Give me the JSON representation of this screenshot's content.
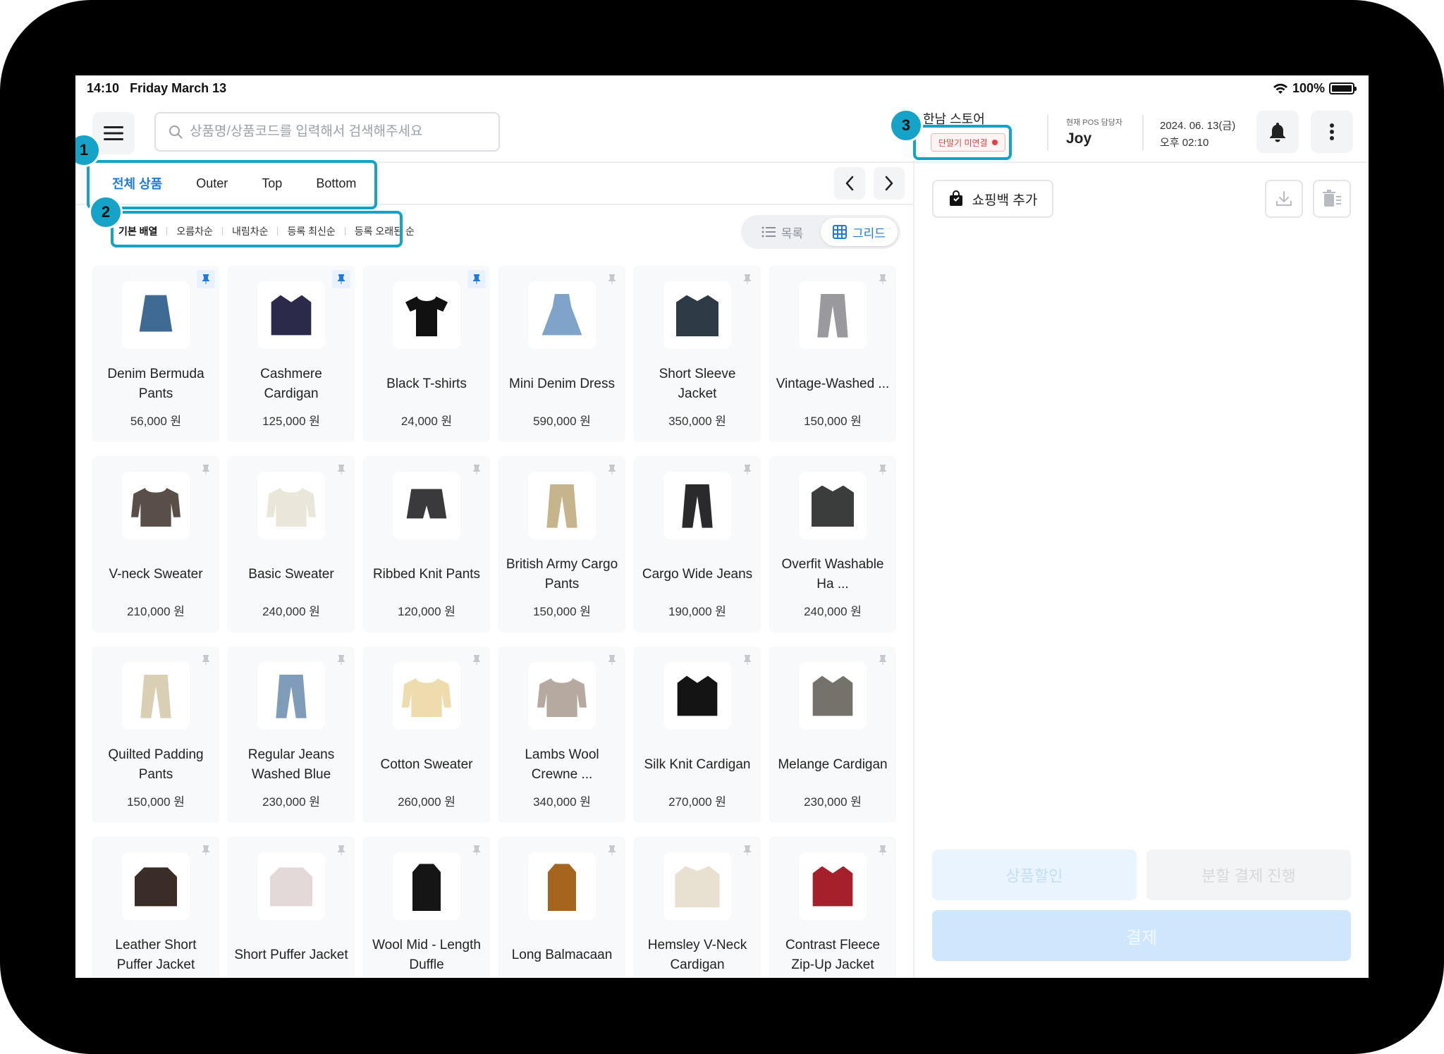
{
  "status_bar": {
    "time": "14:10",
    "date": "Friday March 13",
    "battery": "100%"
  },
  "header": {
    "search_placeholder": "상품명/상품코드를 입력해서 검색해주세요",
    "store_name": "한남 스토어",
    "terminal_status": "단말기 미연결",
    "staff_label": "현재 POS 담당자",
    "staff_name": "Joy",
    "date": "2024. 06. 13(금)",
    "time": "오후 02:10"
  },
  "tabs": [
    {
      "label": "전체 상품",
      "active": true
    },
    {
      "label": "Outer",
      "active": false
    },
    {
      "label": "Top",
      "active": false
    },
    {
      "label": "Bottom",
      "active": false
    }
  ],
  "sort_options": [
    {
      "label": "기본 배열",
      "active": true
    },
    {
      "label": "오름차순",
      "active": false
    },
    {
      "label": "내림차순",
      "active": false
    },
    {
      "label": "등록 최신순",
      "active": false
    },
    {
      "label": "등록 오래된 순",
      "active": false
    }
  ],
  "view_toggle": {
    "list_label": "목록",
    "grid_label": "그리드",
    "active": "grid"
  },
  "products": [
    {
      "name": "Denim Bermuda Pants",
      "price": "56,000 원",
      "pinned": true,
      "icon": "denim-skirt",
      "color": "#3f6a94"
    },
    {
      "name": "Cashmere Cardigan",
      "price": "125,000 원",
      "pinned": true,
      "icon": "cardigan",
      "color": "#2c2a4a"
    },
    {
      "name": "Black T-shirts",
      "price": "24,000 원",
      "pinned": true,
      "icon": "tshirt",
      "color": "#111111"
    },
    {
      "name": "Mini Denim Dress",
      "price": "590,000 원",
      "pinned": false,
      "icon": "dress",
      "color": "#7fa3c9"
    },
    {
      "name": "Short Sleeve Jacket",
      "price": "350,000 원",
      "pinned": false,
      "icon": "jacket",
      "color": "#2e3a45"
    },
    {
      "name": "Vintage-Washed ...",
      "price": "150,000 원",
      "pinned": false,
      "icon": "pants",
      "color": "#9a9a9e"
    },
    {
      "name": "V-neck Sweater",
      "price": "210,000 원",
      "pinned": false,
      "icon": "sweater",
      "color": "#5a4f48"
    },
    {
      "name": "Basic Sweater",
      "price": "240,000 원",
      "pinned": false,
      "icon": "sweater",
      "color": "#ebe6da"
    },
    {
      "name": "Ribbed Knit Pants",
      "price": "120,000 원",
      "pinned": false,
      "icon": "shorts",
      "color": "#3a3a3c"
    },
    {
      "name": "British Army Cargo Pants",
      "price": "150,000 원",
      "pinned": false,
      "icon": "pants",
      "color": "#c5b48c"
    },
    {
      "name": "Cargo Wide Jeans",
      "price": "190,000 원",
      "pinned": false,
      "icon": "pants",
      "color": "#2a2a2c"
    },
    {
      "name": "Overfit Washable Ha ...",
      "price": "240,000 원",
      "pinned": false,
      "icon": "jacket",
      "color": "#3a3d3b"
    },
    {
      "name": "Quilted Padding Pants",
      "price": "150,000 원",
      "pinned": false,
      "icon": "pants",
      "color": "#d9cfb5"
    },
    {
      "name": "Regular Jeans Washed Blue",
      "price": "230,000 원",
      "pinned": false,
      "icon": "pants",
      "color": "#7f9db8"
    },
    {
      "name": "Cotton Sweater",
      "price": "260,000 원",
      "pinned": false,
      "icon": "sweater",
      "color": "#eedcae"
    },
    {
      "name": "Lambs Wool Crewne ...",
      "price": "340,000 원",
      "pinned": false,
      "icon": "sweater",
      "color": "#b6aaa0"
    },
    {
      "name": "Silk Knit Cardigan",
      "price": "270,000 원",
      "pinned": false,
      "icon": "cardigan",
      "color": "#141414"
    },
    {
      "name": "Melange Cardigan",
      "price": "230,000 원",
      "pinned": false,
      "icon": "cardigan",
      "color": "#75726c"
    },
    {
      "name": "Leather Short Puffer Jacket",
      "price": "",
      "pinned": false,
      "icon": "puffer",
      "color": "#3a2c26"
    },
    {
      "name": "Short Puffer Jacket",
      "price": "",
      "pinned": false,
      "icon": "puffer",
      "color": "#e4d9d9"
    },
    {
      "name": "Wool Mid - Length Duffle",
      "price": "",
      "pinned": false,
      "icon": "coat",
      "color": "#151515"
    },
    {
      "name": "Long Balmacaan",
      "price": "",
      "pinned": false,
      "icon": "coat",
      "color": "#a5651f"
    },
    {
      "name": "Hemsley V-Neck Cardigan",
      "price": "",
      "pinned": false,
      "icon": "fleece",
      "color": "#e8e0d0"
    },
    {
      "name": "Contrast Fleece Zip-Up Jacket",
      "price": "",
      "pinned": false,
      "icon": "cardigan",
      "color": "#a5202a"
    }
  ],
  "cart": {
    "add_bag_label": "쇼핑백 추가",
    "discount_label": "상품할인",
    "split_label": "분할 결제 진행",
    "pay_label": "결제"
  },
  "callouts": [
    "1",
    "2",
    "3"
  ],
  "colors": {
    "accent": "#1f7ae0",
    "highlight": "#14a2c6",
    "alert": "#ef3b3b"
  }
}
